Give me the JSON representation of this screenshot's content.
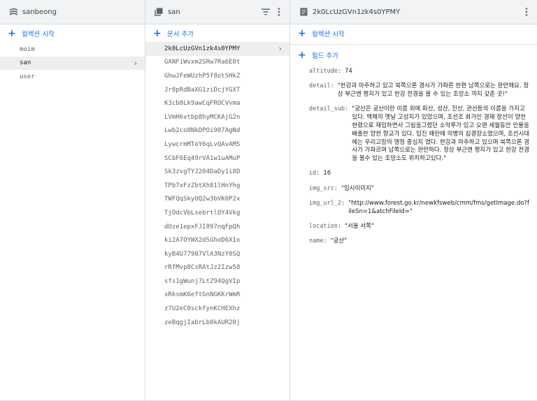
{
  "panel1": {
    "title": "sanbeong",
    "icon": "database-icon",
    "action": "컬렉션 시작",
    "items": [
      "moim",
      "san",
      "user"
    ],
    "selected": "san"
  },
  "panel2": {
    "title": "san",
    "icon": "collection-icon",
    "action": "문서 추가",
    "selected": "2k0LcUzGVn1zk4s0YPMY",
    "items": [
      "2k0LcUzGVn1zk4s0YPMY",
      "GANFiWvxm2SRw7Ra6E8t",
      "GhwJFeWUzhP5f8otSHkZ",
      "Jr8pRdBaXG1ziDcjYGXT",
      "K3cb8Lk9awCqFROCVvma",
      "LVmH6vtbp8hyMCKAjG2n",
      "Lwb2co8NkDPOi907AgNd",
      "LywcrmMToY6qLvQAvAMS",
      "SCbF6Eq49rVA1w1uAMuP",
      "Sk3zvgTYJ204DaDy1i8D",
      "TPb7xFzZbtXh81lHnYhg",
      "TWFQqSkyOQ2w3bVK0P2x",
      "TjOdcVbLsebrtlOY4Vkg",
      "dOze1epxFJI897nqFpQh",
      "ki2A7OYWX2dSGhoD6X1x",
      "kyB4U77907VlA3NzY0SQ",
      "rRfMvp8CsRAtJz2Izw58",
      "sfs1gWunj7LtZ94QgVIp",
      "xRksmK6eftGnNGKKrWmR",
      "z7U2eC0sckfynKCHEXhz",
      "zeBqgjIabrLb8kAUR20j"
    ]
  },
  "panel3": {
    "title": "2k0LcUzGVn1zk4s0YPMY",
    "icon": "document-icon",
    "action": "컬렉션 시작",
    "field_action": "필드 추가",
    "fields": [
      {
        "key": "altitude:",
        "value": "74"
      },
      {
        "key": "detail:",
        "value": "\"한강과 마주하고 있고 북쪽으론 경사가 가파른 한편 남쪽으로는 완만해요. 정상 부근엔 평지가 있고 한강 전경을 볼 수 있는 조망소 까지 갖춘 곳!\""
      },
      {
        "key": "detail_sub:",
        "value": "\"궁산은 궁산이란 이름 외에 파산, 성산, 진산, 관산등의 이름을 가지고 있다. 백제의 옛날 고성지가 있었으며, 조선조 화가인 경재 정선이 양천 현령으로 재임하면서 그림을그렸던 소악루가 있고 오랜 세월동안 인물을 배출한 양천 향교가 있다. 임진 왜란때 의병의 집결장소였으며, 조선시대에는 우리고장의 행정 중심지 였다. 한강과 마주하고 있으며 북쪽으론 경사가 가파르며 남쪽으로는 완만하다. 정상 부근엔 평지가 있고 한강 전경을 볼수 있는 조망소도 위치하고있다.\""
      },
      {
        "key": "id:",
        "value": "16"
      },
      {
        "key": "img_src:",
        "value": "\"임시이미지\""
      },
      {
        "key": "img_url_2:",
        "value": "\"http://www.forest.go.kr/newkfsweb/cmm/fms/getImage.do?fileSn=1&atchFileId=\""
      },
      {
        "key": "location:",
        "value": "\"서울 서쪽\""
      },
      {
        "key": "name:",
        "value": "\"궁산\""
      }
    ]
  },
  "colors": {
    "accent": "#1a73e8",
    "header_bg": "#f1f3f4",
    "selected_bg": "#eeeeef",
    "border": "#dadce0"
  }
}
